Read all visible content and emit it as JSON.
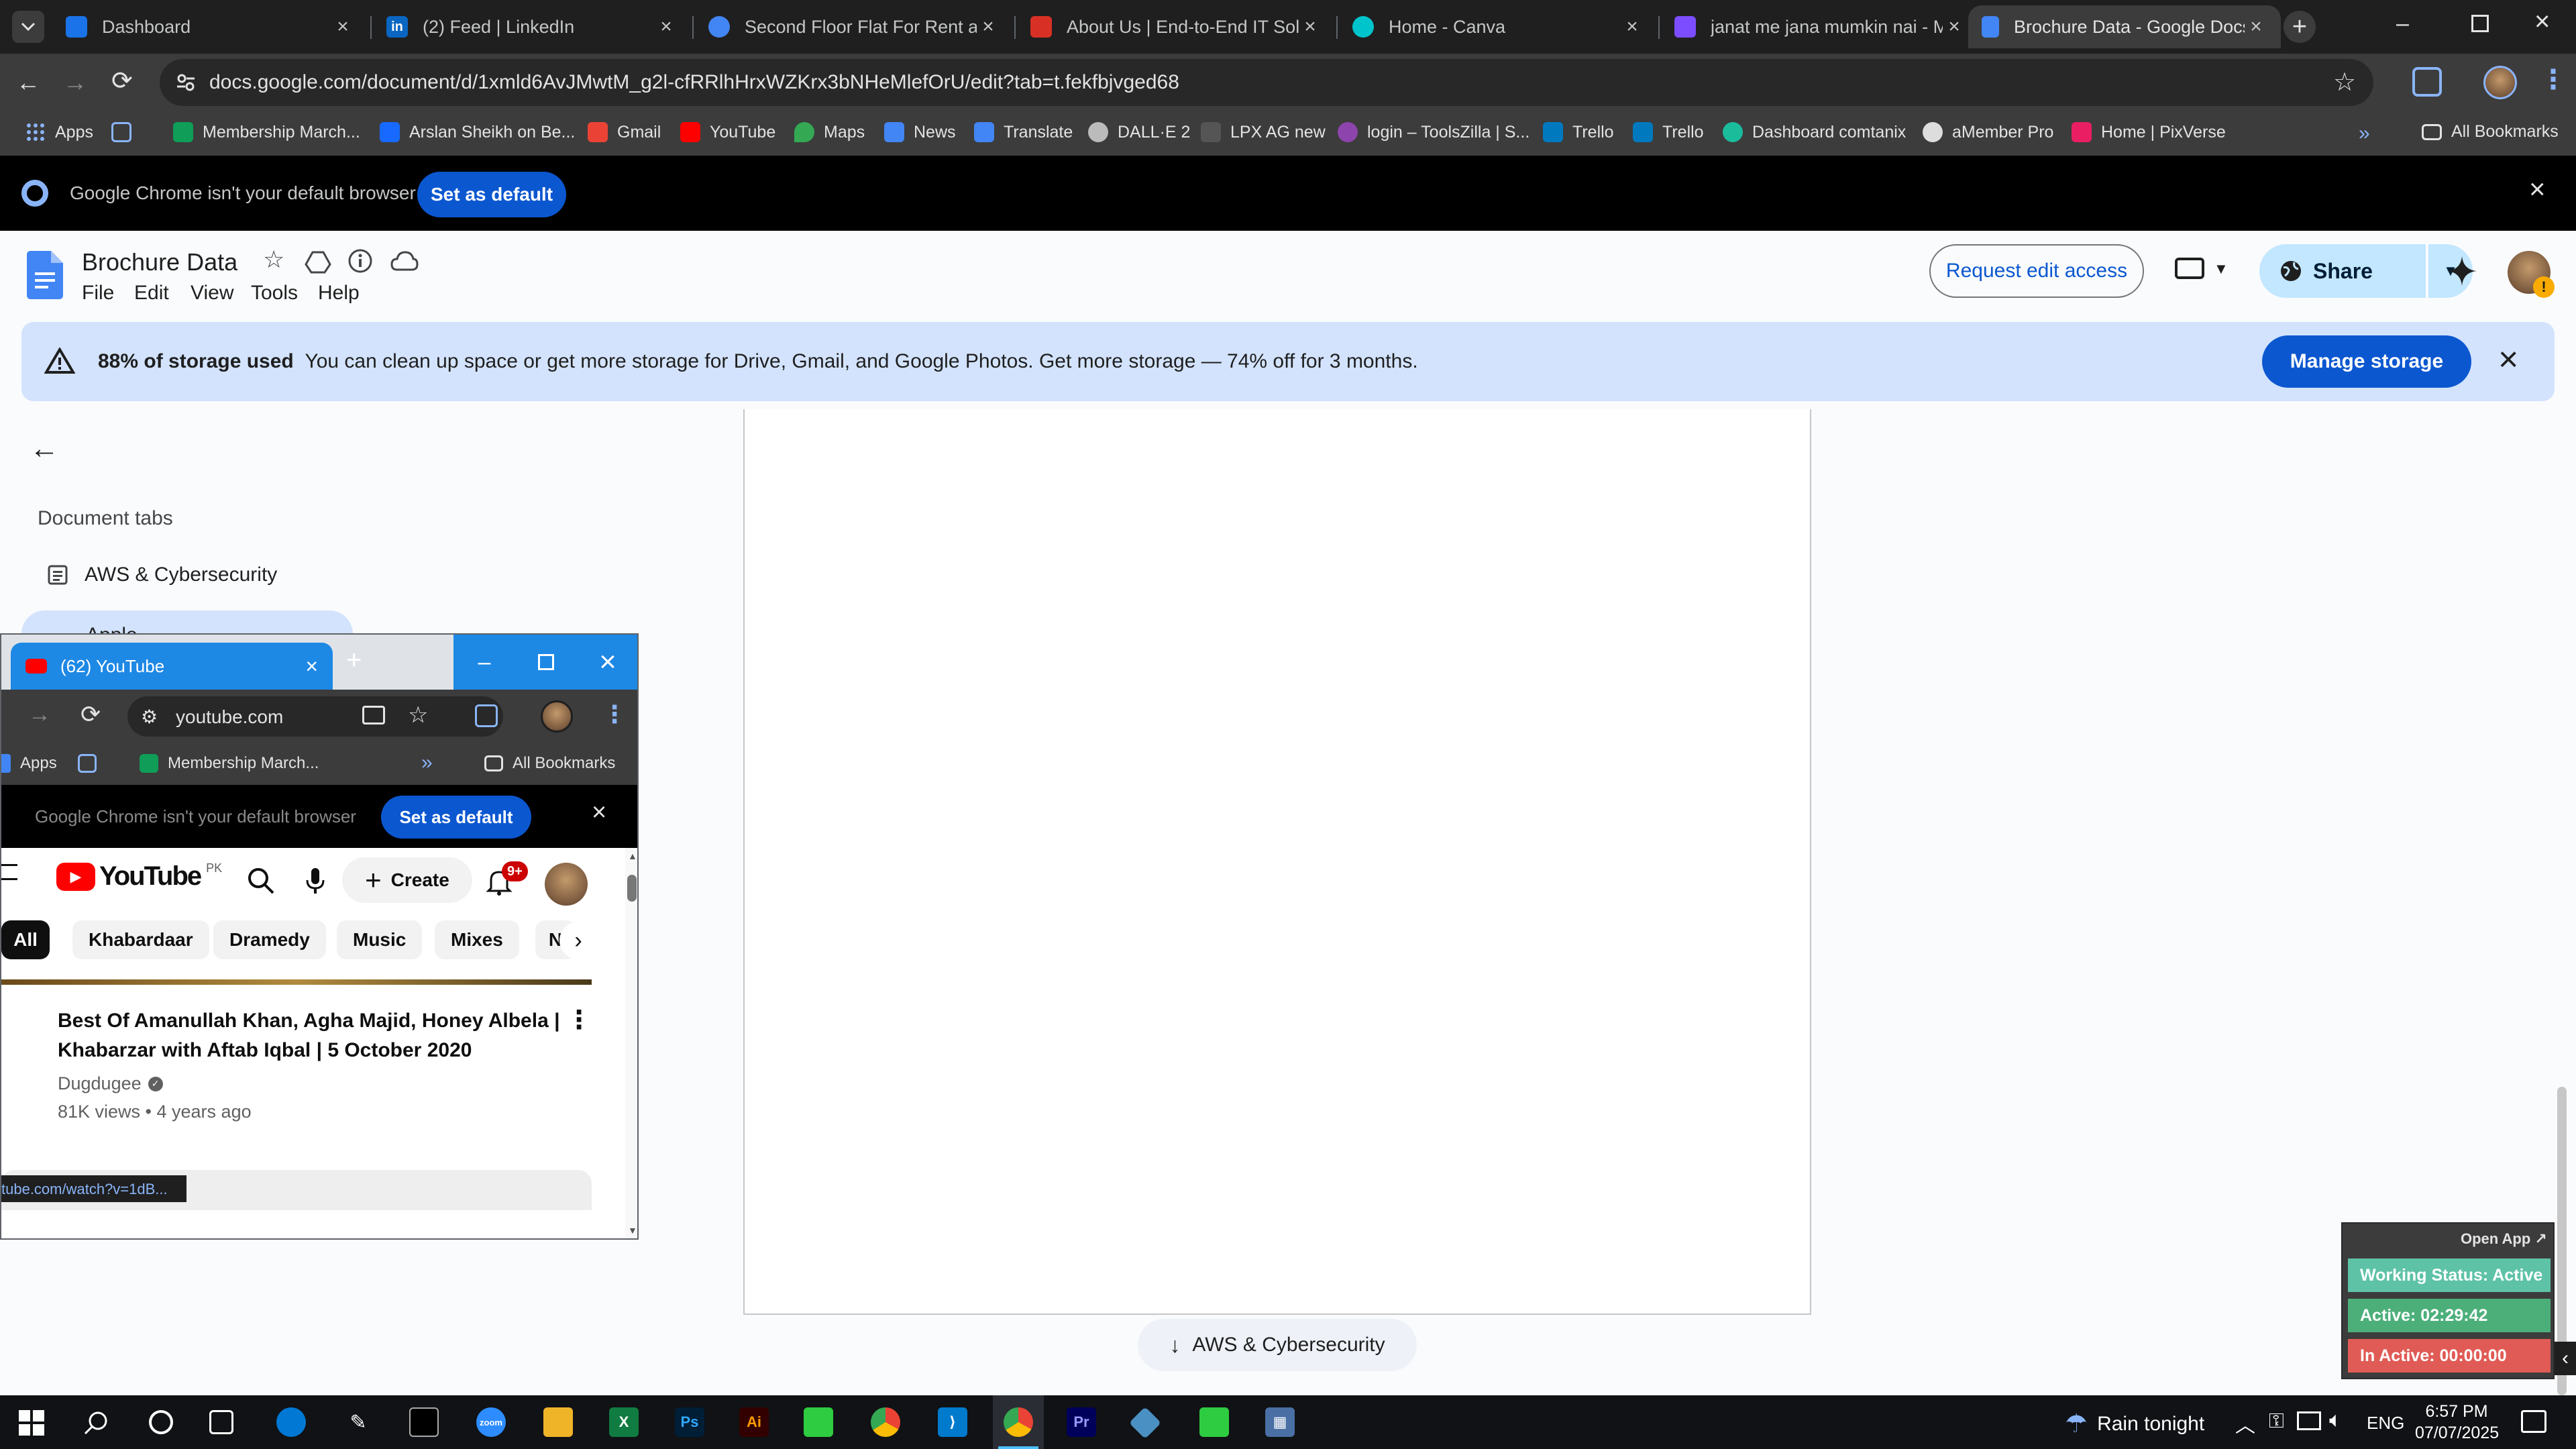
{
  "browser": {
    "tabs": [
      {
        "label": "Dashboard",
        "color": "#1a73e8"
      },
      {
        "label": "(2) Feed | LinkedIn",
        "color": "#0a66c2"
      },
      {
        "label": "Second Floor Flat For Rent at A",
        "color": "#4285f4"
      },
      {
        "label": "About Us | End-to-End IT Soluti",
        "color": "#d93025"
      },
      {
        "label": "Home - Canva",
        "color": "#00c4cc"
      },
      {
        "label": "janat me jana mumkin nai - Mo",
        "color": "#7c4dff"
      },
      {
        "label": "Brochure Data - Google Docs",
        "color": "#4285f4"
      }
    ],
    "url": "docs.google.com/document/d/1xmld6AvJMwtM_g2l-cfRRlhHrxWZKrx3bNHeMlefOrU/edit?tab=t.fekfbjvged68",
    "bookmarks": [
      {
        "label": "Apps",
        "color": "#4285f4"
      },
      {
        "label": "",
        "color": "#8ab4f8"
      },
      {
        "label": "Membership March...",
        "color": "#0f9d58"
      },
      {
        "label": "Arslan Sheikh on Be...",
        "color": "#1769ff"
      },
      {
        "label": "Gmail",
        "color": "#ea4335"
      },
      {
        "label": "YouTube",
        "color": "#ff0000"
      },
      {
        "label": "Maps",
        "color": "#34a853"
      },
      {
        "label": "News",
        "color": "#4285f4"
      },
      {
        "label": "Translate",
        "color": "#4285f4"
      },
      {
        "label": "DALL·E 2",
        "color": "#bbbbbb"
      },
      {
        "label": "LPX AG new",
        "color": "#555555"
      },
      {
        "label": "login – ToolsZilla | S...",
        "color": "#8e44ad"
      },
      {
        "label": "Trello",
        "color": "#0079bf"
      },
      {
        "label": "Trello",
        "color": "#0079bf"
      },
      {
        "label": "Dashboard comtanix",
        "color": "#1abc9c"
      },
      {
        "label": "aMember Pro",
        "color": "#dddddd"
      },
      {
        "label": "Home | PixVerse",
        "color": "#e91e63"
      }
    ],
    "all_bookmarks": "All Bookmarks",
    "infobar": {
      "text": "Google Chrome isn't your default browser",
      "button": "Set as default"
    }
  },
  "docs": {
    "title": "Brochure Data",
    "menu": [
      "File",
      "Edit",
      "View",
      "Tools",
      "Help"
    ],
    "request_edit": "Request edit access",
    "share": "Share",
    "storage": {
      "bold": "88% of storage used",
      "text": "You can clean up space or get more storage for Drive, Gmail, and Google Photos. Get more storage — 74% off for 3 months.",
      "button": "Manage storage"
    },
    "sidebar": {
      "heading": "Document tabs",
      "tabs": [
        "AWS & Cybersecurity",
        "Apple"
      ]
    },
    "jump_button": "AWS & Cybersecurity"
  },
  "youtube_window": {
    "tab_label": "(62) YouTube",
    "url": "youtube.com",
    "bookmarks": [
      "Apps",
      "Membership March..."
    ],
    "all_bookmarks": "All Bookmarks",
    "infobar": {
      "text": "Google Chrome isn't your default browser",
      "button": "Set as default"
    },
    "logo": "YouTube",
    "country": "PK",
    "create": "Create",
    "notifications": "9+",
    "chips": [
      "All",
      "Khabardaar",
      "Dramedy",
      "Music",
      "Mixes",
      "N"
    ],
    "video": {
      "title": "Best Of Amanullah Khan, Agha Majid, Honey Albela | Khabarzar with Aftab Iqbal | 5 October 2020",
      "channel": "Dugdugee",
      "meta": "81K views • 4 years ago"
    },
    "status_url": "tube.com/watch?v=1dB..."
  },
  "widget": {
    "open_app": "Open App ↗",
    "working_status": "Working Status: Active",
    "active": "Active: 02:29:42",
    "inactive": "In Active: 00:00:00"
  },
  "taskbar": {
    "weather": "Rain tonight",
    "language": "ENG",
    "time": "6:57 PM",
    "date": "07/07/2025"
  }
}
